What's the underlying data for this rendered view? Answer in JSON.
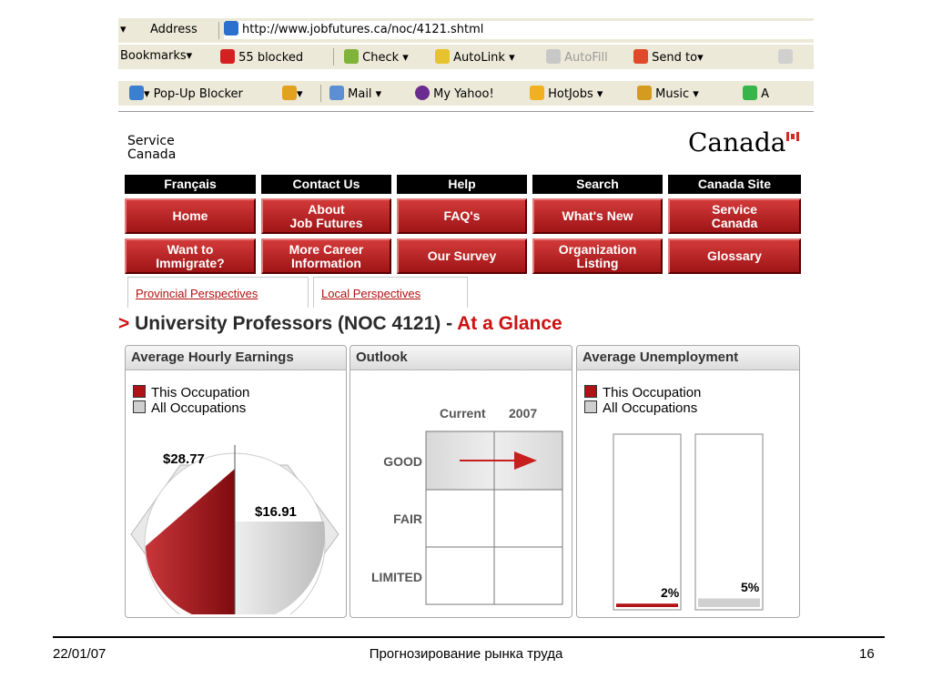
{
  "browser": {
    "address_label": "Address",
    "url": "http://www.jobfutures.ca/noc/4121.shtml",
    "toolbar2": [
      "Bookmarks",
      "55 blocked",
      "Check",
      "AutoLink",
      "AutoFill",
      "Send to"
    ],
    "toolbar3": [
      "Pop-Up Blocker",
      "Mail",
      "My Yahoo!",
      "HotJobs",
      "Music",
      "A"
    ]
  },
  "site": {
    "logo_small_line1": "Service",
    "logo_small_line2": "Canada",
    "logo_canada": "Canada",
    "nav_top": [
      "Français",
      "Contact Us",
      "Help",
      "Search",
      "Canada Site"
    ],
    "nav_row1": [
      "Home",
      "About\nJob Futures",
      "FAQ's",
      "What's New",
      "Service\nCanada"
    ],
    "nav_row2": [
      "Want to\nImmigrate?",
      "More Career\nInformation",
      "Our Survey",
      "Organization\nListing",
      "Glossary"
    ],
    "tabs": [
      "Provincial Perspectives",
      "Local Perspectives"
    ],
    "heading_main": "University Professors (NOC 4121) - ",
    "heading_red": "At a Glance",
    "heading_arrow": ">"
  },
  "panels": {
    "earnings": {
      "title": "Average Hourly Earnings",
      "legend": [
        "This Occupation",
        "All Occupations"
      ],
      "this_value": "$28.77",
      "all_value": "$16.91"
    },
    "outlook": {
      "title": "Outlook",
      "col_headers": [
        "Current",
        "2007"
      ],
      "rows": [
        "GOOD",
        "FAIR",
        "LIMITED"
      ]
    },
    "unemployment": {
      "title": "Average Unemployment",
      "legend": [
        "This Occupation",
        "All Occupations"
      ],
      "this_value": "2%",
      "all_value": "5%"
    }
  },
  "chart_data": [
    {
      "type": "pie",
      "categories": [
        "This Occupation",
        "All Occupations"
      ],
      "values": [
        28.77,
        16.91
      ],
      "title": "Average Hourly Earnings"
    },
    {
      "type": "bar",
      "categories": [
        "This Occupation",
        "All Occupations"
      ],
      "values": [
        2,
        5
      ],
      "title": "Average Unemployment"
    }
  ],
  "footer": {
    "date": "22/01/07",
    "center": "Прогнозирование рынка труда",
    "page": "16"
  },
  "colors": {
    "brand_red": "#b01316",
    "nav_black": "#000000"
  }
}
